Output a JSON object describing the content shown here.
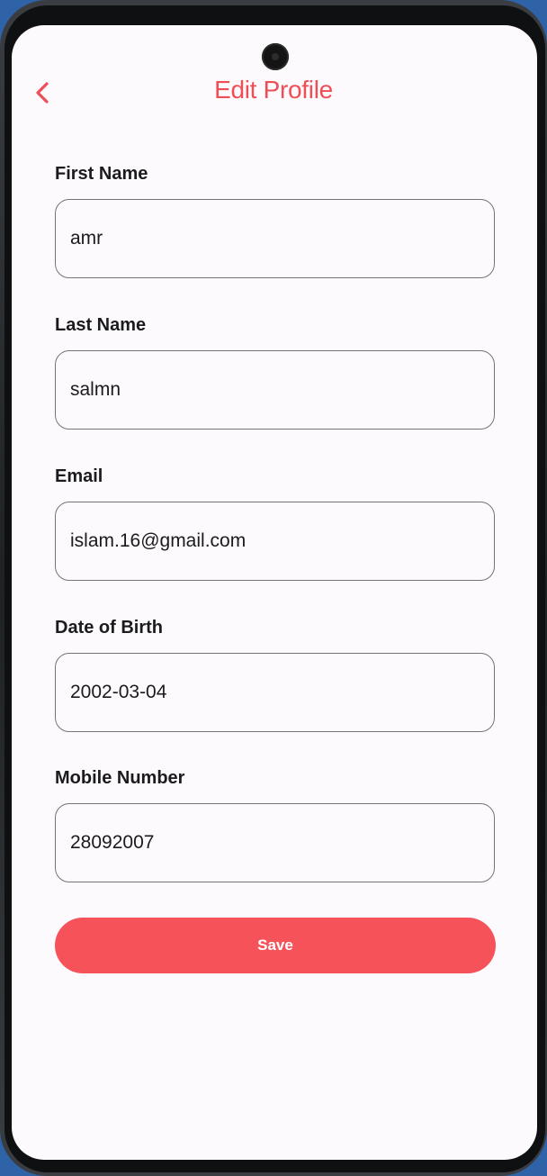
{
  "header": {
    "title": "Edit Profile",
    "back_icon": "chevron-left-icon"
  },
  "form": {
    "first_name": {
      "label": "First Name",
      "value": "amr"
    },
    "last_name": {
      "label": "Last Name",
      "value": "salmn"
    },
    "email": {
      "label": "Email",
      "value": "islam.16@gmail.com"
    },
    "date_of_birth": {
      "label": "Date of Birth",
      "value": "2002-03-04"
    },
    "mobile_number": {
      "label": "Mobile Number",
      "value": "28092007"
    }
  },
  "actions": {
    "save_label": "Save"
  },
  "colors": {
    "accent": "#f5525a",
    "title": "#ee4f57",
    "background": "#fdfafd",
    "input_border": "#75727a"
  }
}
